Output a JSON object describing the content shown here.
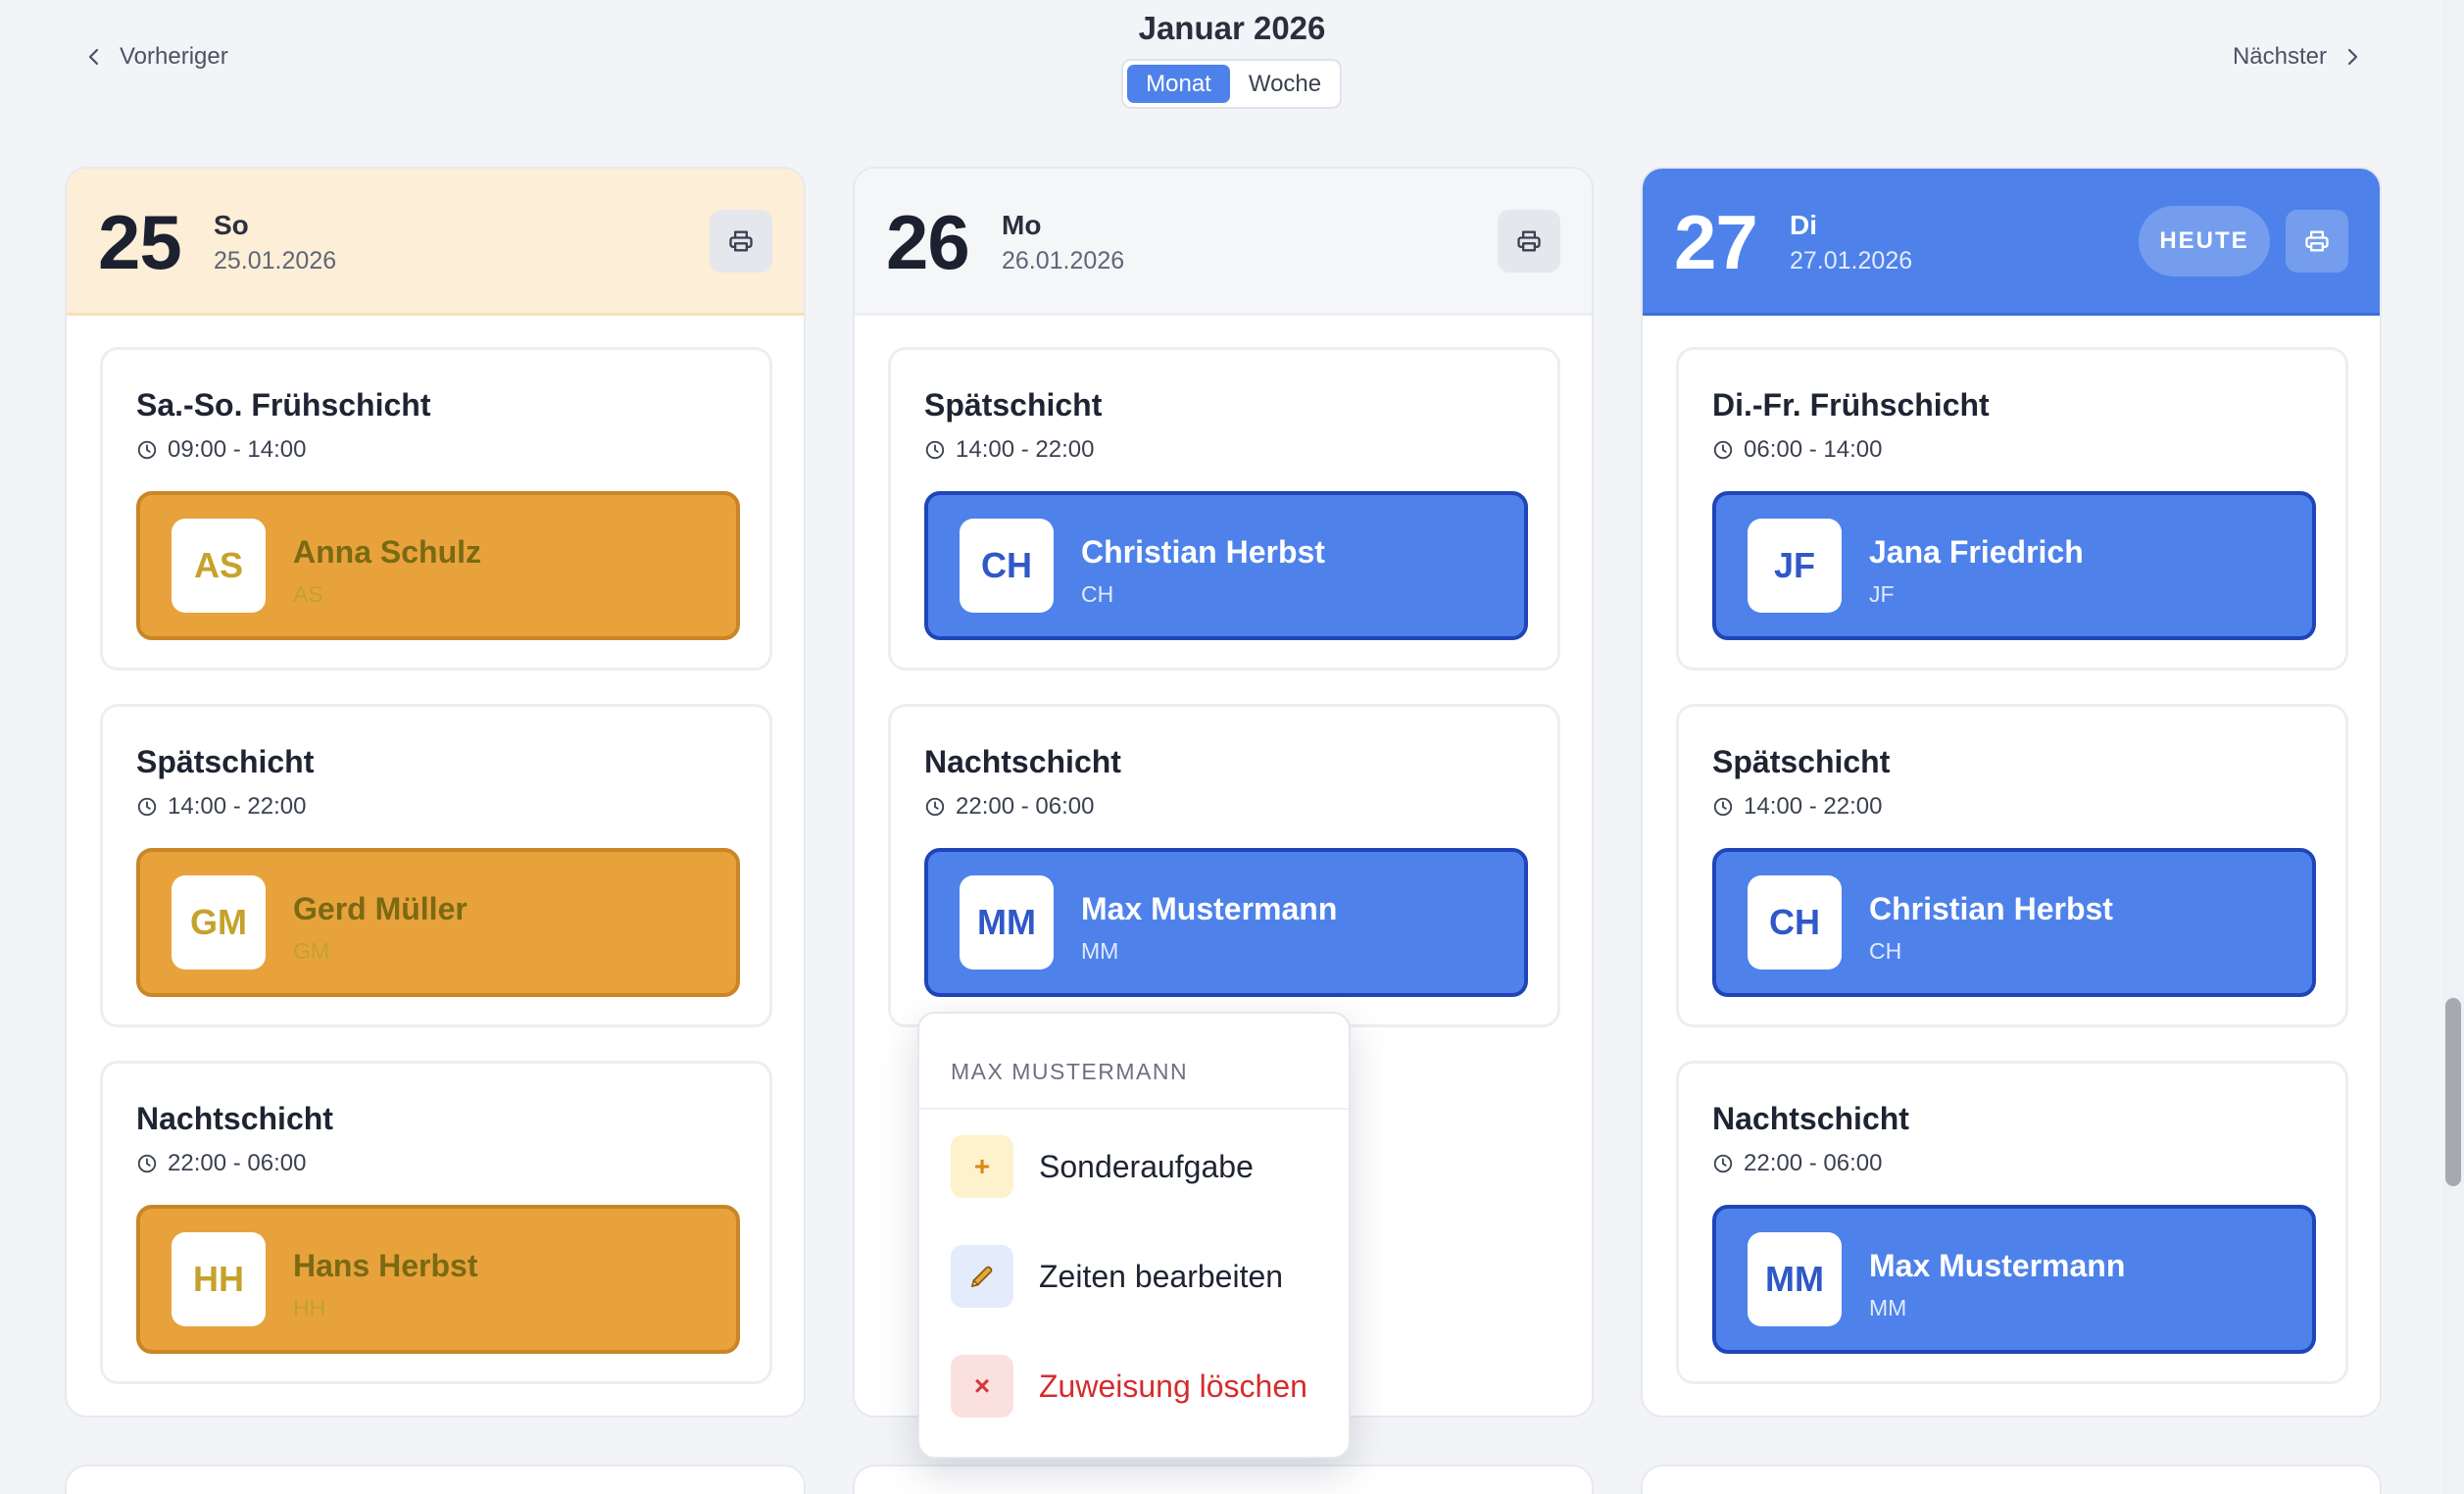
{
  "header": {
    "prev_label": "Vorheriger",
    "next_label": "Nächster",
    "title": "Januar 2026",
    "view_month": "Monat",
    "view_week": "Woche"
  },
  "days": [
    {
      "number": "25",
      "weekday": "So",
      "date": "25.01.2026",
      "shifts": [
        {
          "title": "Sa.-So. Frühschicht",
          "time": "09:00 - 14:00",
          "assignee": {
            "name": "Anna Schulz",
            "initials": "AS"
          }
        },
        {
          "title": "Spätschicht",
          "time": "14:00 - 22:00",
          "assignee": {
            "name": "Gerd Müller",
            "initials": "GM"
          }
        },
        {
          "title": "Nachtschicht",
          "time": "22:00 - 06:00",
          "assignee": {
            "name": "Hans Herbst",
            "initials": "HH"
          }
        }
      ]
    },
    {
      "number": "26",
      "weekday": "Mo",
      "date": "26.01.2026",
      "shifts": [
        {
          "title": "Spätschicht",
          "time": "14:00 - 22:00",
          "assignee": {
            "name": "Christian Herbst",
            "initials": "CH"
          }
        },
        {
          "title": "Nachtschicht",
          "time": "22:00 - 06:00",
          "assignee": {
            "name": "Max Mustermann",
            "initials": "MM"
          }
        }
      ]
    },
    {
      "number": "27",
      "weekday": "Di",
      "date": "27.01.2026",
      "today_label": "HEUTE",
      "shifts": [
        {
          "title": "Di.-Fr. Frühschicht",
          "time": "06:00 - 14:00",
          "assignee": {
            "name": "Jana Friedrich",
            "initials": "JF"
          }
        },
        {
          "title": "Spätschicht",
          "time": "14:00 - 22:00",
          "assignee": {
            "name": "Christian Herbst",
            "initials": "CH"
          }
        },
        {
          "title": "Nachtschicht",
          "time": "22:00 - 06:00",
          "assignee": {
            "name": "Max Mustermann",
            "initials": "MM"
          }
        }
      ]
    }
  ],
  "context_menu": {
    "header": "MAX MUSTERMANN",
    "items": [
      {
        "label": "Sonderaufgabe",
        "icon": "plus-icon"
      },
      {
        "label": "Zeiten bearbeiten",
        "icon": "pencil-icon"
      },
      {
        "label": "Zuweisung löschen",
        "icon": "close-icon"
      }
    ]
  },
  "colors": {
    "accent": "#4e82ea",
    "weekend_header": "#fdeed7",
    "weekend_assignee": "#e8a23c",
    "danger": "#d62c2c"
  }
}
